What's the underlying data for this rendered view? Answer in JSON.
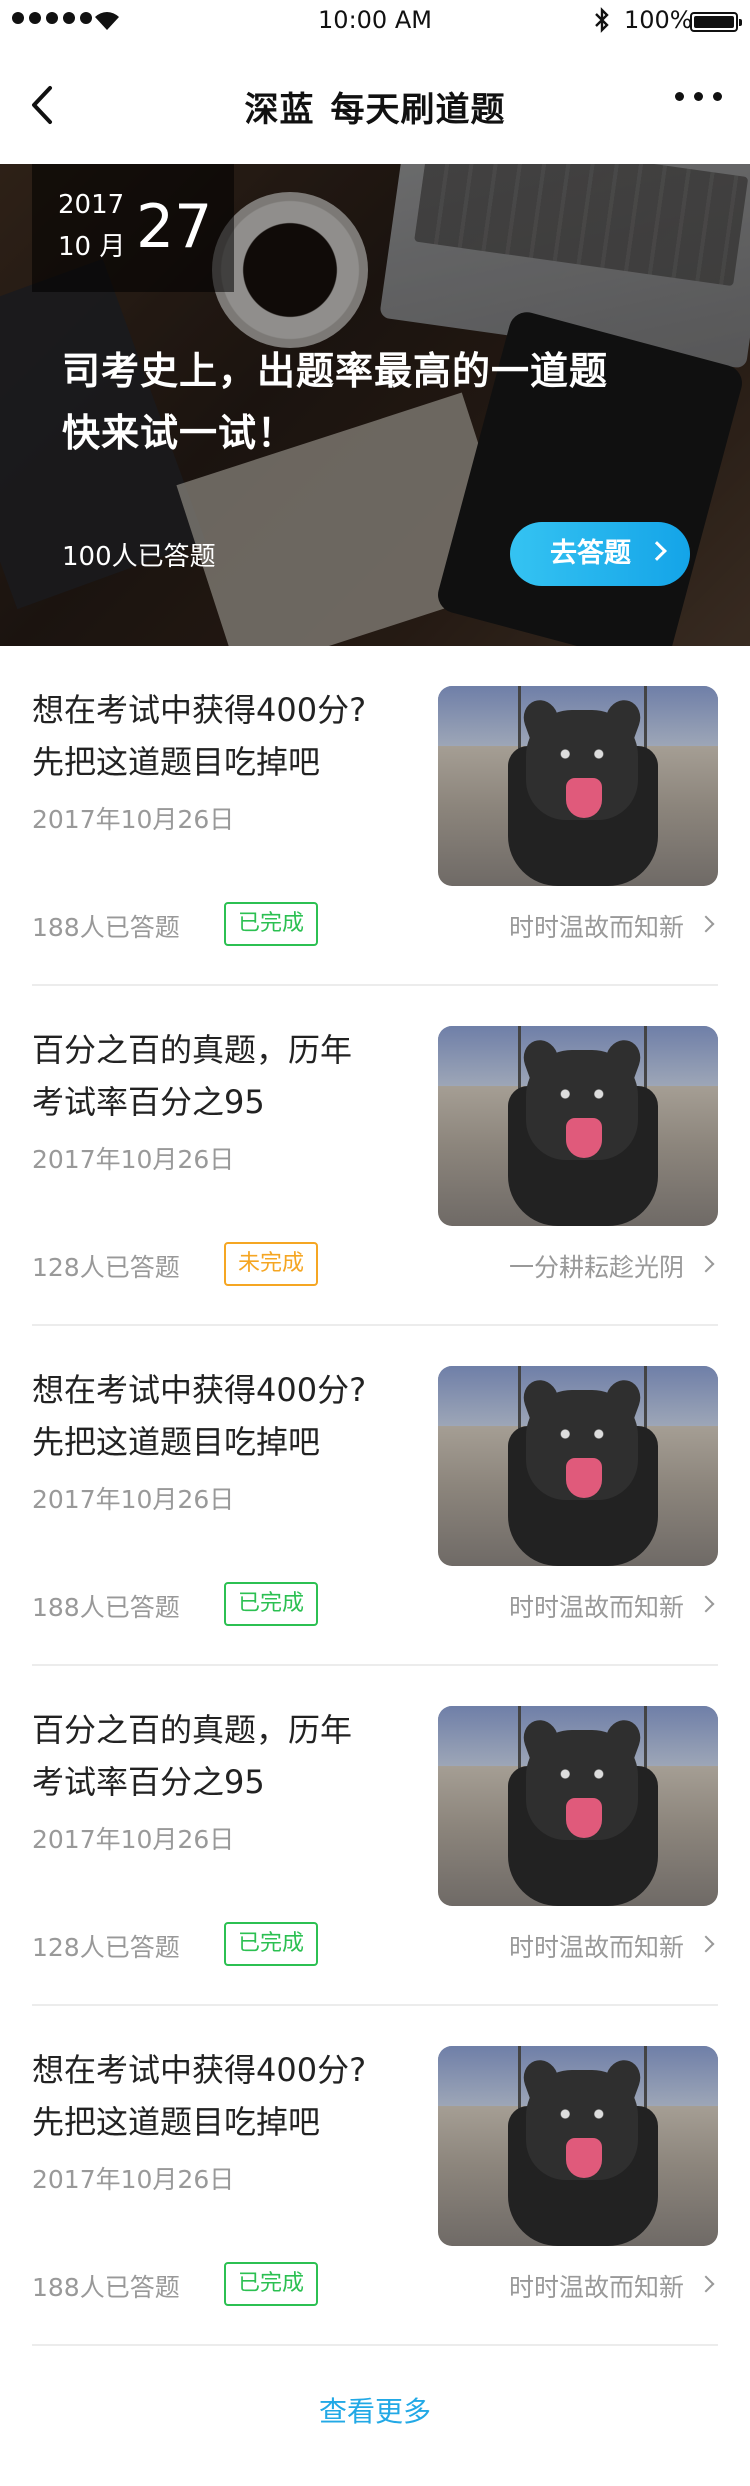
{
  "status_bar": {
    "time": "10:00 AM",
    "battery": "100%"
  },
  "nav": {
    "title_part1": "深蓝",
    "title_part2": "每天刷道题"
  },
  "hero": {
    "year": "2017",
    "month": "10 月",
    "day": "27",
    "headline_line1": "司考史上，出题率最高的一道题",
    "headline_line2": "快来试一试！",
    "answered_count": "100人已答题",
    "cta_label": "去答题"
  },
  "items": [
    {
      "title_line1": "想在考试中获得400分?",
      "title_line2": "先把这道题目吃掉吧",
      "date": "2017年10月26日",
      "answered": "188人已答题",
      "status": "已完成",
      "tagline": "时时温故而知新"
    },
    {
      "title_line1": "百分之百的真题，历年",
      "title_line2": "考试率百分之95",
      "date": "2017年10月26日",
      "answered": "128人已答题",
      "status": "未完成",
      "tagline": "一分耕耘趁光阴"
    },
    {
      "title_line1": "想在考试中获得400分?",
      "title_line2": "先把这道题目吃掉吧",
      "date": "2017年10月26日",
      "answered": "188人已答题",
      "status": "已完成",
      "tagline": "时时温故而知新"
    },
    {
      "title_line1": "百分之百的真题，历年",
      "title_line2": "考试率百分之95",
      "date": "2017年10月26日",
      "answered": "128人已答题",
      "status": "已完成",
      "tagline": "时时温故而知新"
    },
    {
      "title_line1": "想在考试中获得400分?",
      "title_line2": "先把这道题目吃掉吧",
      "date": "2017年10月26日",
      "answered": "188人已答题",
      "status": "已完成",
      "tagline": "时时温故而知新"
    }
  ],
  "footer": {
    "see_more": "查看更多"
  },
  "colors": {
    "accent": "#22a9e6",
    "done": "#2cc052",
    "todo": "#f5a623"
  }
}
